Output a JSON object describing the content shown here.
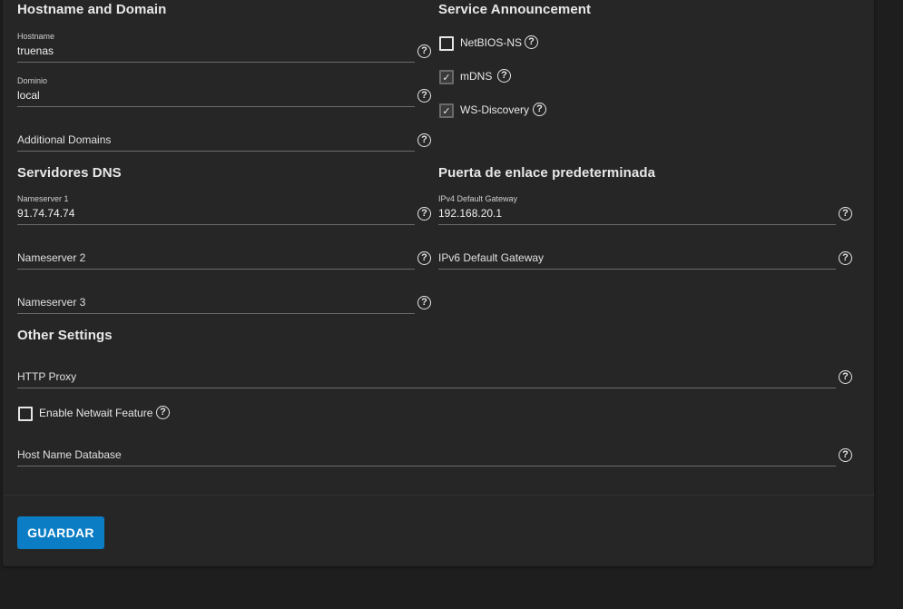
{
  "sections": {
    "hostname": "Hostname and Domain",
    "announcement": "Service Announcement",
    "dns": "Servidores DNS",
    "gateway": "Puerta de enlace predeterminada",
    "other": "Other Settings"
  },
  "fields": {
    "hostname": {
      "label": "Hostname",
      "value": "truenas"
    },
    "domain": {
      "label": "Dominio",
      "value": "local"
    },
    "additional_domains": {
      "placeholder": "Additional Domains"
    },
    "ns1": {
      "label": "Nameserver 1",
      "value": "91.74.74.74"
    },
    "ns2": {
      "placeholder": "Nameserver 2"
    },
    "ns3": {
      "placeholder": "Nameserver 3"
    },
    "ipv4": {
      "label": "IPv4 Default Gateway",
      "value": "192.168.20.1"
    },
    "ipv6": {
      "placeholder": "IPv6 Default Gateway"
    },
    "http_proxy": {
      "placeholder": "HTTP Proxy"
    },
    "host_db": {
      "placeholder": "Host Name Database"
    }
  },
  "checkboxes": {
    "netbios": {
      "label": "NetBIOS-NS",
      "checked": false
    },
    "mdns": {
      "label": "mDNS",
      "checked": true
    },
    "wsd": {
      "label": "WS-Discovery",
      "checked": true
    },
    "netwait": {
      "label": "Enable Netwait Feature",
      "checked": false
    }
  },
  "help_glyph": "?",
  "check_glyph": "✓",
  "save_label": "GUARDAR",
  "colors": {
    "accent": "#0b7dc4",
    "background": "#1e1e1e",
    "card": "#262626"
  }
}
